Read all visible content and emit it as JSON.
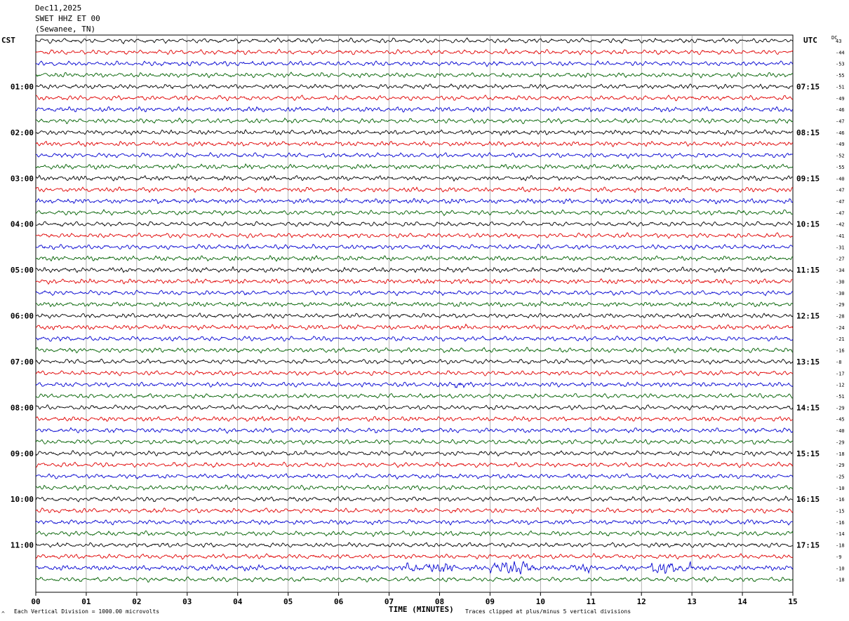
{
  "header": {
    "date": "Dec11,2025",
    "station": "SWET HHZ ET 00",
    "location": "(Sewanee, TN)"
  },
  "left_tz": "CST",
  "right_tz": "UTC",
  "dc_label": "DC",
  "footer": {
    "scale_note": "Each Vertical Division = 1000.00 microvolts",
    "clip_note": "Traces clipped at plus/minus 5 vertical divisions",
    "corner_mark": "^"
  },
  "colors": {
    "cycle": [
      "#000000",
      "#e00000",
      "#0000d0",
      "#006000"
    ],
    "grid": "#808080"
  },
  "chart_data": {
    "type": "line",
    "title": "",
    "xlabel": "TIME (MINUTES)",
    "ylabel": "",
    "x_ticks": [
      "00",
      "01",
      "02",
      "03",
      "04",
      "05",
      "06",
      "07",
      "08",
      "09",
      "10",
      "11",
      "12",
      "13",
      "14",
      "15"
    ],
    "xlim": [
      0,
      15
    ],
    "traces_per_hour": 4,
    "rows": 48,
    "left_hour_labels": [
      "01:00",
      "02:00",
      "03:00",
      "04:00",
      "05:00",
      "06:00",
      "07:00",
      "08:00",
      "09:00",
      "10:00",
      "11:00"
    ],
    "right_hour_labels": [
      "07:15",
      "08:15",
      "09:15",
      "10:15",
      "11:15",
      "12:15",
      "13:15",
      "14:15",
      "15:15",
      "16:15",
      "17:15"
    ],
    "dc_offsets": [
      "43",
      "-44",
      "-53",
      "-55",
      "-51",
      "-49",
      "-46",
      "-47",
      "-46",
      "-49",
      "-52",
      "-55",
      "-40",
      "-47",
      "-47",
      "-47",
      "-42",
      "-41",
      "-31",
      "-27",
      "-34",
      "-30",
      "-30",
      "-29",
      "-28",
      "-24",
      "-21",
      "-16",
      "-8",
      "-17",
      "-12",
      "-51",
      "-29",
      "-45",
      "-40",
      "-29",
      "-18",
      "-29",
      "-25",
      "-10",
      "-16",
      "-15",
      "-16",
      "-14",
      "-18",
      "-9",
      "-10",
      "-18"
    ],
    "events": [
      {
        "row": 30,
        "x_start_min": 8.3,
        "x_end_min": 8.6,
        "amplitude": 2.2
      },
      {
        "row": 46,
        "x_start_min": 3.0,
        "x_end_min": 4.6,
        "amplitude": 1.6
      },
      {
        "row": 46,
        "x_start_min": 7.3,
        "x_end_min": 8.3,
        "amplitude": 2.6
      },
      {
        "row": 46,
        "x_start_min": 9.0,
        "x_end_min": 9.9,
        "amplitude": 4.0
      },
      {
        "row": 46,
        "x_start_min": 10.6,
        "x_end_min": 11.0,
        "amplitude": 2.2
      },
      {
        "row": 46,
        "x_start_min": 12.1,
        "x_end_min": 13.0,
        "amplitude": 3.0
      }
    ]
  }
}
